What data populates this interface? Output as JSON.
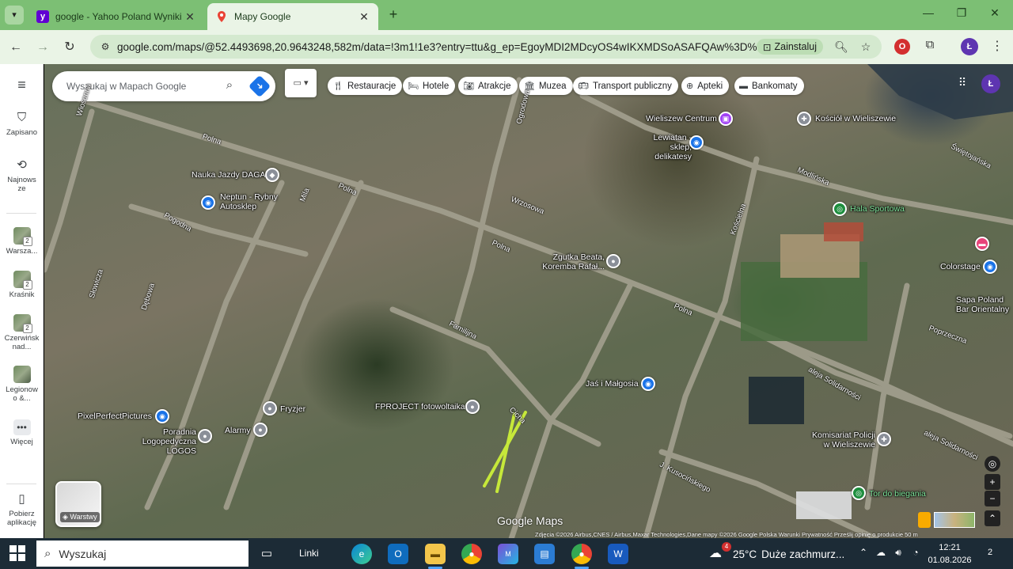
{
  "browser": {
    "tabs": [
      {
        "title": "google - Yahoo Poland Wyniki wy",
        "favicon": "yahoo-icon",
        "active": false
      },
      {
        "title": "Mapy Google",
        "favicon": "maps-pin-icon",
        "active": true
      }
    ],
    "url": "google.com/maps/@52.4493698,20.9643248,582m/data=!3m1!1e3?entry=ttu&g_ep=EgoyMDI2MDcyOS4wIKXMDSoASAFQAw%3D%3D",
    "install_label": "Zainstaluj",
    "profile_letter": "Ł",
    "theme_color": "#7cbf74"
  },
  "sidebar": {
    "menu": "≡",
    "items": [
      {
        "label": "Zapisano",
        "icon": "bookmark-icon"
      },
      {
        "label": "Najnowsze",
        "icon": "history-icon"
      },
      {
        "label": "Warsza...",
        "badge": "2"
      },
      {
        "label": "Kraśnik",
        "badge": "2"
      },
      {
        "label": "Czerwińsk nad...",
        "badge": "2"
      },
      {
        "label": "Legionowo &..."
      },
      {
        "label": "Więcej",
        "icon": "more-icon"
      },
      {
        "label": "Pobierz aplikację",
        "icon": "phone-icon"
      }
    ]
  },
  "map": {
    "search_placeholder": "Wyszukaj w Mapach Google",
    "chips": [
      "Restauracje",
      "Hotele",
      "Atrakcje",
      "Muzea",
      "Transport publiczny",
      "Apteki",
      "Bankomaty"
    ],
    "profile_letter": "Ł",
    "layers_label": "Warstwy",
    "logo": "Google Maps",
    "attribution": "Zdjęcia ©2026 Airbus,CNES / Airbus,Maxar Technologies,Dane mapy ©2026 Google   Polska   Warunki   Prywatność   Prześlij opinię o produkcie   50 m",
    "places": [
      {
        "name": "Nauka Jazdy DAGA"
      },
      {
        "name": "Neptun - Rybny Autosklep"
      },
      {
        "name": "Wieliszew Centrum"
      },
      {
        "name": "Lewiatan - sklep, delikatesy"
      },
      {
        "name": "Kościół w Wieliszewie"
      },
      {
        "name": "Hala Sportowa"
      },
      {
        "name": "Colorstage"
      },
      {
        "name": "Sapa Poland Bar Orientalny"
      },
      {
        "name": "Zgutka Beata, Koremba Rafał..."
      },
      {
        "name": "Jaś i Małgosia"
      },
      {
        "name": "FPROJECT fotowoltaika"
      },
      {
        "name": "Fryzjer"
      },
      {
        "name": "Alarmy"
      },
      {
        "name": "PixelPerfectPictures"
      },
      {
        "name": "Poradnia Logopedyczna LOGOS"
      },
      {
        "name": "Komisariat Policji w Wieliszewie"
      },
      {
        "name": "Tor do biegania"
      }
    ],
    "streets": [
      "Polna",
      "Polna",
      "Polna",
      "Polna",
      "Wiosenna",
      "Pogodna",
      "Ogrodowa",
      "Wrzosowa",
      "Familijna",
      "Cicha",
      "Kościelna",
      "Modlińska",
      "Poprzeczna",
      "aleja Solidarności",
      "aleja Solidarności",
      "J. Kusocińskiego",
      "Mila",
      "Dębowa",
      "Słowicza",
      "Świętojańska"
    ]
  },
  "taskbar": {
    "search_placeholder": "Wyszukaj",
    "links_label": "Linki",
    "weather_temp": "25°C",
    "weather_desc": "Duże zachmurz...",
    "weather_badge": "4",
    "time": "12:21",
    "date": "01.08.2026",
    "notifications": "2"
  }
}
